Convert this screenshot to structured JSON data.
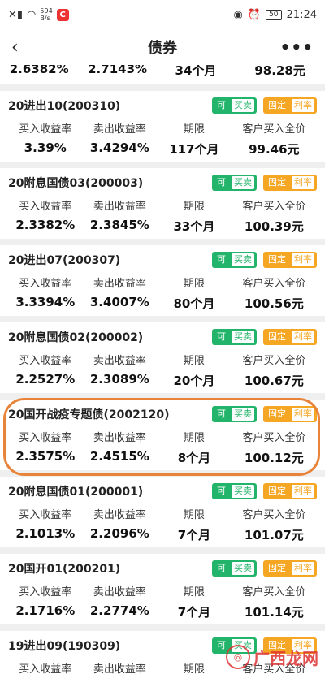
{
  "status": {
    "net_speed_value": "594",
    "net_speed_unit": "B/s",
    "app_badge": "C",
    "battery": "50",
    "time": "21:24"
  },
  "nav": {
    "back": "‹",
    "title": "债券",
    "more": "•••"
  },
  "columns": [
    "买入收益率",
    "卖出收益率",
    "期限",
    "客户买入全价"
  ],
  "partial": {
    "buy": "2.6382%",
    "sell": "2.7143%",
    "term": "34个月",
    "price": "98.28元"
  },
  "tags": {
    "can": "可",
    "trade": "买卖",
    "fixed": "固定",
    "rate": "利率"
  },
  "bonds": [
    {
      "name": "20进出10(200310)",
      "buy": "3.39%",
      "sell": "3.4294%",
      "term": "117个月",
      "price": "99.46元"
    },
    {
      "name": "20附息国债03(200003)",
      "buy": "2.3382%",
      "sell": "2.3845%",
      "term": "33个月",
      "price": "100.39元"
    },
    {
      "name": "20进出07(200307)",
      "buy": "3.3394%",
      "sell": "3.4007%",
      "term": "80个月",
      "price": "100.56元"
    },
    {
      "name": "20附息国债02(200002)",
      "buy": "2.2527%",
      "sell": "2.3089%",
      "term": "20个月",
      "price": "100.67元"
    },
    {
      "name": "20国开战疫专题债(2002120)",
      "buy": "2.3575%",
      "sell": "2.4515%",
      "term": "8个月",
      "price": "100.12元"
    },
    {
      "name": "20附息国债01(200001)",
      "buy": "2.1013%",
      "sell": "2.2096%",
      "term": "7个月",
      "price": "101.07元"
    },
    {
      "name": "20国开01(200201)",
      "buy": "2.1716%",
      "sell": "2.2774%",
      "term": "7个月",
      "price": "101.14元"
    },
    {
      "name": "19进出09(190309)",
      "buy": "",
      "sell": "",
      "term": "",
      "price": ""
    }
  ],
  "watermark": "广西龙网"
}
